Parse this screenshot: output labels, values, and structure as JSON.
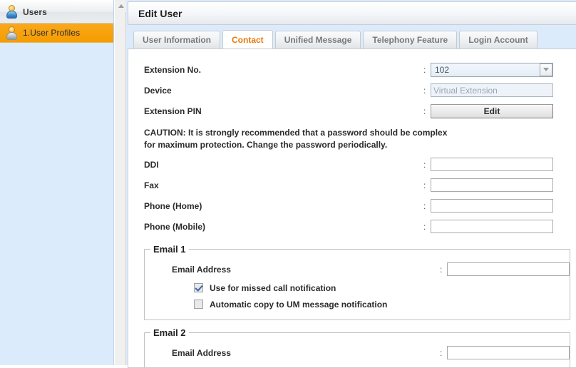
{
  "sidebar": {
    "header": {
      "label": "Users",
      "icon": "user-icon"
    },
    "items": [
      {
        "label": "1.User Profiles",
        "icon": "user-icon",
        "selected": true
      }
    ]
  },
  "header": {
    "title": "Edit User"
  },
  "tabs": [
    {
      "label": "User Information",
      "active": false
    },
    {
      "label": "Contact",
      "active": true
    },
    {
      "label": "Unified Message",
      "active": false
    },
    {
      "label": "Telephony Feature",
      "active": false
    },
    {
      "label": "Login Account",
      "active": false
    }
  ],
  "form": {
    "separator": ":",
    "extension_no": {
      "label": "Extension No.",
      "value": "102"
    },
    "device": {
      "label": "Device",
      "value": "Virtual Extension"
    },
    "extension_pin": {
      "label": "Extension PIN",
      "button_label": "Edit"
    },
    "caution": "CAUTION: It is strongly recommended that a password should be complex for maximum protection. Change the password periodically.",
    "ddi": {
      "label": "DDI",
      "value": ""
    },
    "fax": {
      "label": "Fax",
      "value": ""
    },
    "phone_home": {
      "label": "Phone (Home)",
      "value": ""
    },
    "phone_mobile": {
      "label": "Phone (Mobile)",
      "value": ""
    }
  },
  "email1": {
    "legend": "Email 1",
    "address_label": "Email Address",
    "address_value": "",
    "checkbox_missed_call": {
      "label": "Use for missed call notification",
      "checked": true
    },
    "checkbox_um_copy": {
      "label": "Automatic copy to UM message notification",
      "checked": false
    }
  },
  "email2": {
    "legend": "Email 2",
    "address_label": "Email Address",
    "address_value": ""
  },
  "colors": {
    "accent_orange": "#f59c00",
    "tab_active_text": "#e8780a",
    "sidebar_background": "#dcebfb",
    "panel_background": "#ffffff"
  }
}
